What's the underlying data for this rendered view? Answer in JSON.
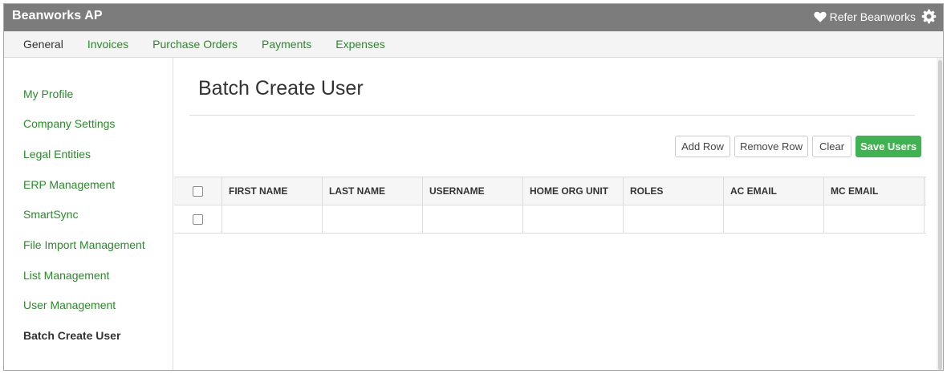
{
  "app": {
    "title": "Beanworks AP"
  },
  "header": {
    "refer_label": "Refer Beanworks"
  },
  "tabs": [
    {
      "label": "General",
      "active": true
    },
    {
      "label": "Invoices"
    },
    {
      "label": "Purchase Orders"
    },
    {
      "label": "Payments"
    },
    {
      "label": "Expenses"
    }
  ],
  "sidebar": {
    "items": [
      {
        "label": "My Profile"
      },
      {
        "label": "Company Settings"
      },
      {
        "label": "Legal Entities"
      },
      {
        "label": "ERP Management"
      },
      {
        "label": "SmartSync"
      },
      {
        "label": "File Import Management"
      },
      {
        "label": "List Management"
      },
      {
        "label": "User Management"
      },
      {
        "label": "Batch Create User",
        "active": true
      }
    ]
  },
  "main": {
    "title": "Batch Create User",
    "buttons": {
      "add_row": "Add Row",
      "remove_row": "Remove Row",
      "clear": "Clear",
      "save_users": "Save Users"
    },
    "table": {
      "columns": [
        "FIRST NAME",
        "LAST NAME",
        "USERNAME",
        "HOME ORG UNIT",
        "ROLES",
        "AC EMAIL",
        "MC EMAIL"
      ],
      "rows": [
        [
          "",
          "",
          "",
          "",
          "",
          "",
          ""
        ]
      ]
    }
  },
  "colors": {
    "header_bg": "#7c7c7c",
    "link_green": "#2a8a2a",
    "primary_button": "#3fb34f"
  },
  "icons": [
    "heart-icon",
    "gear-icon"
  ]
}
